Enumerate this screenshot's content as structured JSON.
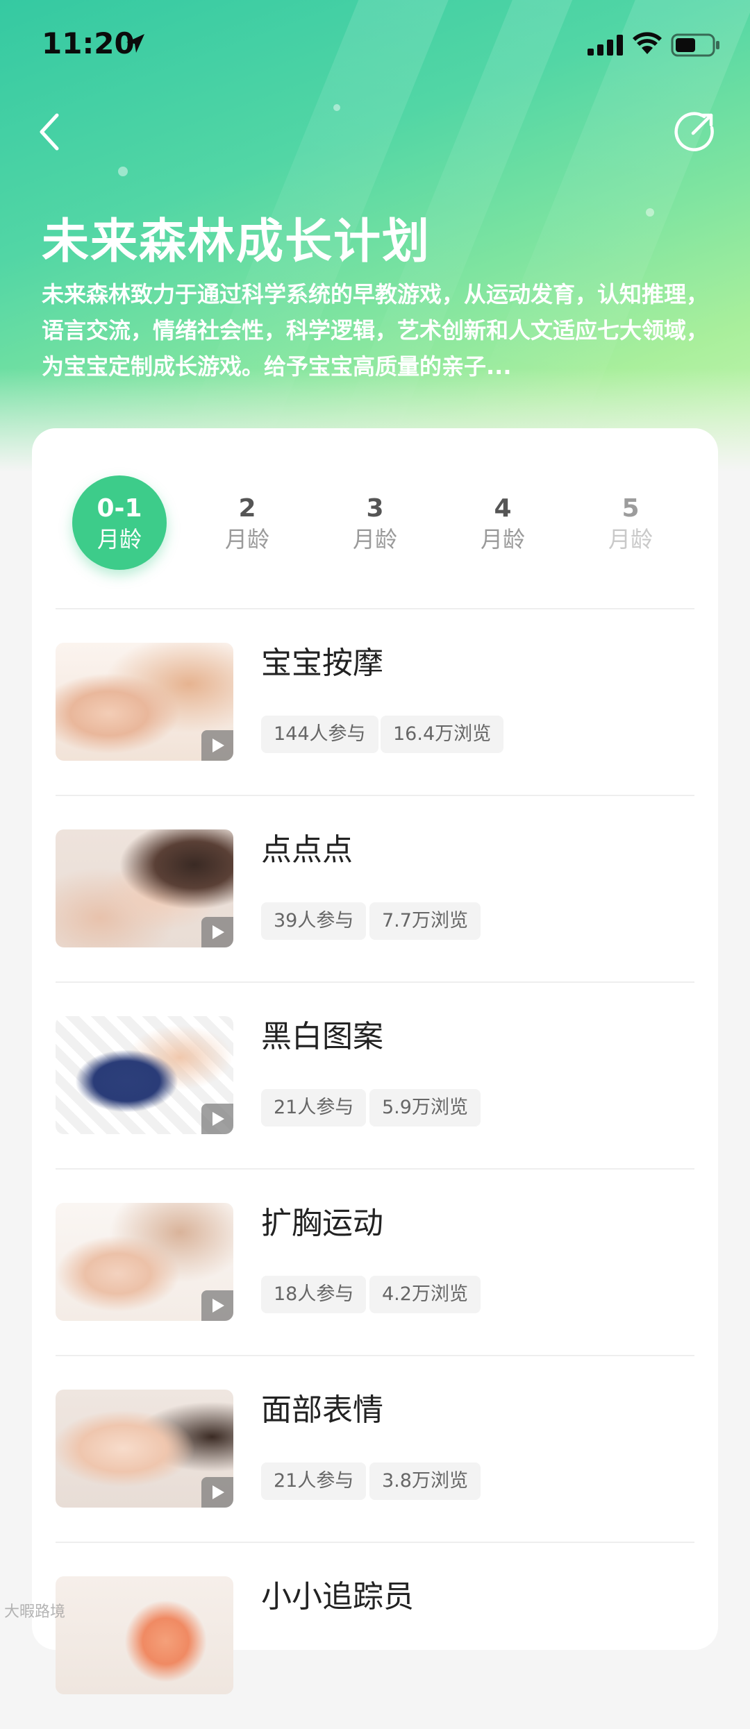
{
  "status_bar": {
    "time": "11:20"
  },
  "header": {
    "title": "未来森林成长计划",
    "description": "未来森林致力于通过科学系统的早教游戏，从运动发育，认知推理，语言交流，情绪社会性，科学逻辑，艺术创新和人文适应七大领域，为宝宝定制成长游戏。给予宝宝高质量的亲子..."
  },
  "age_tabs": [
    {
      "num": "0-1",
      "unit": "月龄"
    },
    {
      "num": "2",
      "unit": "月龄"
    },
    {
      "num": "3",
      "unit": "月龄"
    },
    {
      "num": "4",
      "unit": "月龄"
    },
    {
      "num": "5",
      "unit": "月龄"
    }
  ],
  "activities": [
    {
      "title": "宝宝按摩",
      "participants": "144人参与",
      "views": "16.4万浏览"
    },
    {
      "title": "点点点",
      "participants": "39人参与",
      "views": "7.7万浏览"
    },
    {
      "title": "黑白图案",
      "participants": "21人参与",
      "views": "5.9万浏览"
    },
    {
      "title": "扩胸运动",
      "participants": "18人参与",
      "views": "4.2万浏览"
    },
    {
      "title": "面部表情",
      "participants": "21人参与",
      "views": "3.8万浏览"
    },
    {
      "title": "小小追踪员"
    }
  ],
  "colors": {
    "accent": "#3dcc8a",
    "hero_gradient_start": "#35c9a2",
    "hero_gradient_end": "#c9f6b3"
  },
  "watermark": "大暇路境"
}
